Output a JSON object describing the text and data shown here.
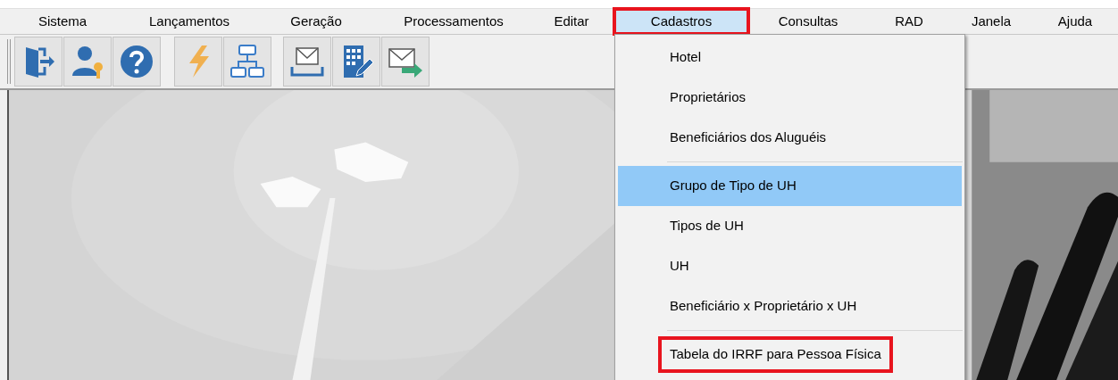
{
  "menubar": {
    "items": [
      {
        "label": "Sistema",
        "selected": false,
        "marked": false
      },
      {
        "label": "Lançamentos",
        "selected": false,
        "marked": false
      },
      {
        "label": "Geração",
        "selected": false,
        "marked": false
      },
      {
        "label": "Processamentos",
        "selected": false,
        "marked": false
      },
      {
        "label": "Editar",
        "selected": false,
        "marked": false
      },
      {
        "label": "Cadastros",
        "selected": true,
        "marked": true
      },
      {
        "label": "Consultas",
        "selected": false,
        "marked": false
      },
      {
        "label": "RAD",
        "selected": false,
        "marked": false
      },
      {
        "label": "Janela",
        "selected": false,
        "marked": false
      },
      {
        "label": "Ajuda",
        "selected": false,
        "marked": false
      }
    ]
  },
  "dropdown": {
    "items": [
      {
        "kind": "item",
        "label": "Hotel",
        "selected": false,
        "marked": false
      },
      {
        "kind": "item",
        "label": "Proprietários",
        "selected": false,
        "marked": false
      },
      {
        "kind": "item",
        "label": "Beneficiários dos Aluguéis",
        "selected": false,
        "marked": false
      },
      {
        "kind": "separator"
      },
      {
        "kind": "item",
        "label": "Grupo de Tipo de UH",
        "selected": true,
        "marked": false
      },
      {
        "kind": "item",
        "label": "Tipos de UH",
        "selected": false,
        "marked": false
      },
      {
        "kind": "item",
        "label": "UH",
        "selected": false,
        "marked": false
      },
      {
        "kind": "item",
        "label": "Beneficiário x Proprietário x UH",
        "selected": false,
        "marked": false
      },
      {
        "kind": "separator"
      },
      {
        "kind": "item",
        "label": "Tabela do IRRF para Pessoa Física",
        "selected": false,
        "marked": true
      }
    ]
  }
}
